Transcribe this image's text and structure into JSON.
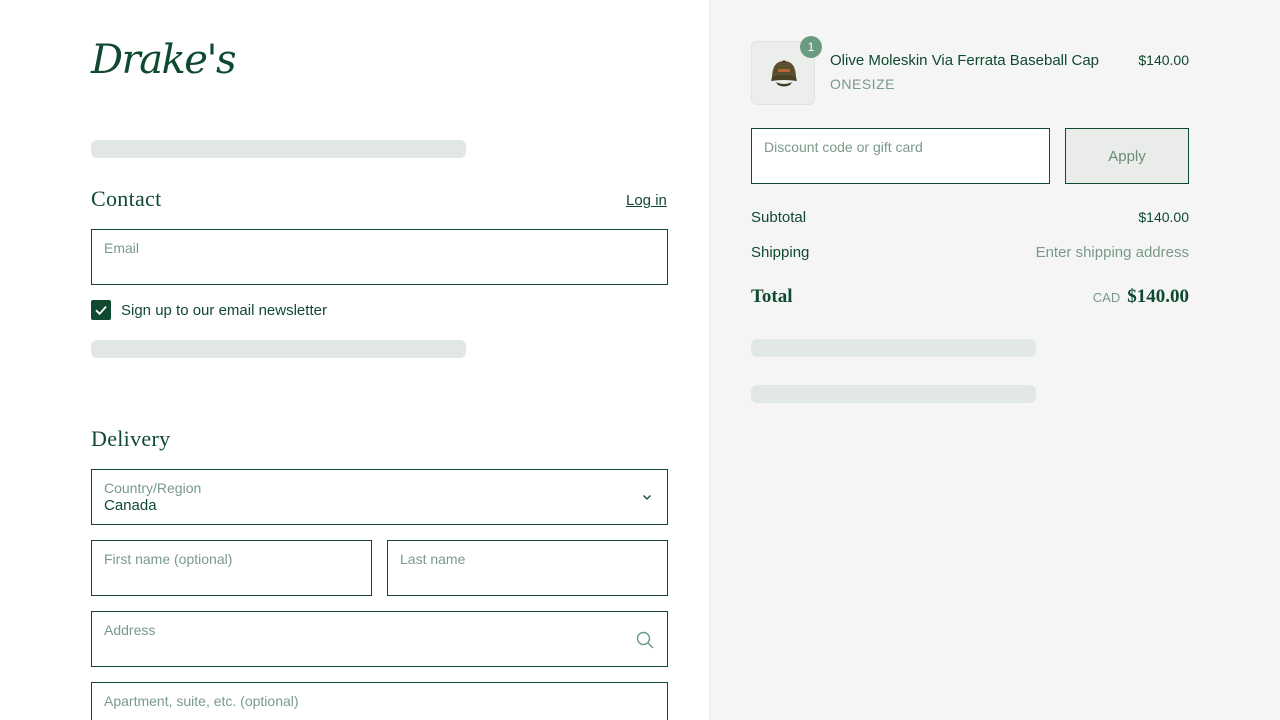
{
  "brand": {
    "logo_text": "Drake's"
  },
  "contact": {
    "title": "Contact",
    "login_label": "Log in",
    "email": {
      "label": "Email",
      "value": ""
    },
    "newsletter": {
      "label": "Sign up to our email newsletter",
      "checked": true
    }
  },
  "delivery": {
    "title": "Delivery",
    "country": {
      "label": "Country/Region",
      "value": "Canada"
    },
    "first_name": {
      "label": "First name (optional)",
      "value": ""
    },
    "last_name": {
      "label": "Last name",
      "value": ""
    },
    "address": {
      "label": "Address",
      "value": ""
    },
    "apartment": {
      "label": "Apartment, suite, etc. (optional)",
      "value": ""
    }
  },
  "summary": {
    "item": {
      "quantity": "1",
      "name": "Olive Moleskin Via Ferrata Baseball Cap",
      "variant": "ONESIZE",
      "price": "$140.00"
    },
    "discount": {
      "placeholder": "Discount code or gift card",
      "apply_label": "Apply"
    },
    "subtotal": {
      "label": "Subtotal",
      "value": "$140.00"
    },
    "shipping": {
      "label": "Shipping",
      "value": "Enter shipping address"
    },
    "total": {
      "label": "Total",
      "currency": "CAD",
      "value": "$140.00"
    }
  },
  "icons": {
    "checkbox": "checkmark-icon",
    "country": "chevron-down-icon",
    "address": "search-icon",
    "product": "baseball-cap-image"
  },
  "colors": {
    "brand_green": "#0f4a30",
    "muted_green": "#7a9a89",
    "badge": "#6b9a82",
    "skeleton": "#e1e8e4",
    "summary_bg": "#f5f5f5"
  }
}
